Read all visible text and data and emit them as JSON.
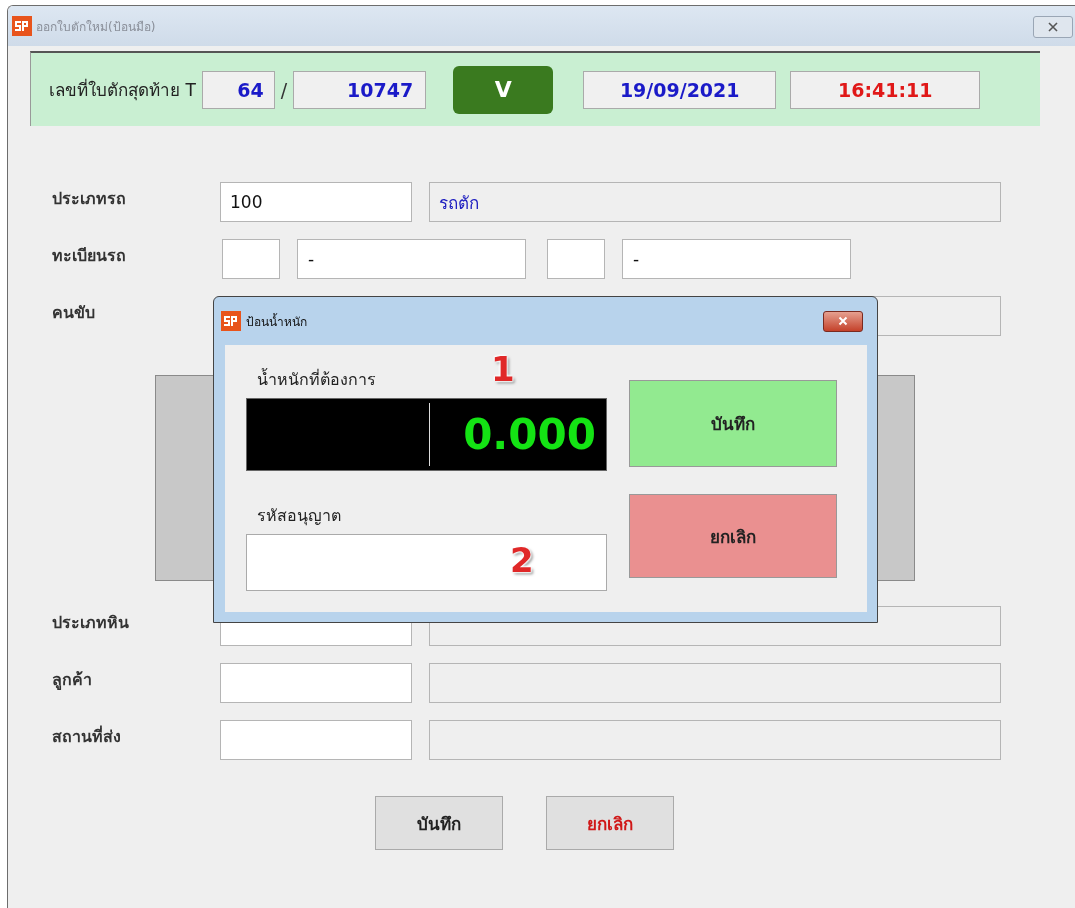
{
  "window": {
    "title": "ออกใบตักใหม่(ป้อนมือ)"
  },
  "header": {
    "label": "เลขที่ใบตักสุดท้าย T",
    "year": "64",
    "separator": "/",
    "number": "10747",
    "status": "V",
    "date": "19/09/2021",
    "time": "16:41:11"
  },
  "form": {
    "rows": [
      {
        "label": "ประเภทรถ",
        "kind": "code",
        "code": "100",
        "name": "รถตัก"
      },
      {
        "label": "ทะเบียนรถ",
        "kind": "plate",
        "values": [
          "-",
          "-"
        ]
      },
      {
        "label": "คนขับ",
        "kind": "covered"
      }
    ],
    "rows_below": [
      {
        "label": "ประเภทหิน",
        "kind": "code"
      },
      {
        "label": "ลูกค้า",
        "kind": "code"
      },
      {
        "label": "สถานที่ส่ง",
        "kind": "code"
      }
    ]
  },
  "buttons": [
    {
      "label": "บันทึก",
      "kind": "save"
    },
    {
      "label": "ยกเลิก",
      "kind": "cancel"
    }
  ],
  "dialog": {
    "title": "ป้อนน้ำหนัก",
    "weight_label": "น้ำหนักที่ต้องการ",
    "weight": "0.000",
    "code_label": "รหัสอนุญาต",
    "markers": [
      "1",
      "2"
    ],
    "buttons": [
      {
        "label": "บันทึก",
        "kind": "save"
      },
      {
        "label": "ยกเลิก",
        "kind": "cancel"
      }
    ]
  }
}
